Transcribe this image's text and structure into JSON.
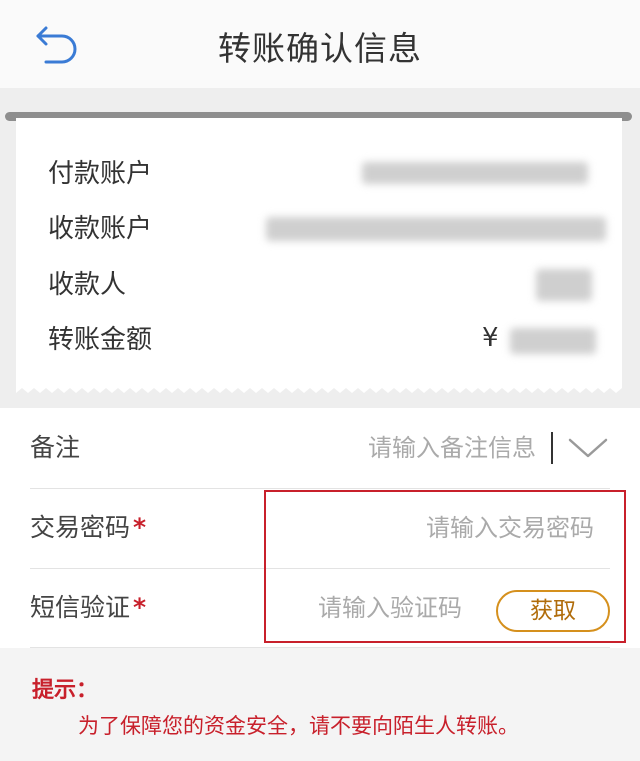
{
  "header": {
    "title": "转账确认信息",
    "back_icon": "back-arrow-icon",
    "accent_color": "#3a7bd5"
  },
  "receipt": {
    "rows": [
      {
        "label": "付款账户",
        "value": ""
      },
      {
        "label": "收款账户",
        "value": ""
      },
      {
        "label": "收款人",
        "value": ""
      },
      {
        "label": "转账金额",
        "value": "",
        "currency_symbol": "¥"
      }
    ]
  },
  "form": {
    "remark": {
      "label": "备注",
      "placeholder": "请输入备注信息",
      "dropdown_icon": "chevron-down-icon"
    },
    "trade_password": {
      "label": "交易密码",
      "required_mark": "*",
      "placeholder": "请输入交易密码"
    },
    "sms_verify": {
      "label": "短信验证",
      "required_mark": "*",
      "placeholder": "请输入验证码",
      "button_label": "获取"
    }
  },
  "tips": {
    "title": "提示：",
    "text": "为了保障您的资金安全，请不要向陌生人转账。"
  },
  "colors": {
    "warning": "#c8202b",
    "button_border": "#d5901d",
    "highlight": "#c8202b"
  }
}
